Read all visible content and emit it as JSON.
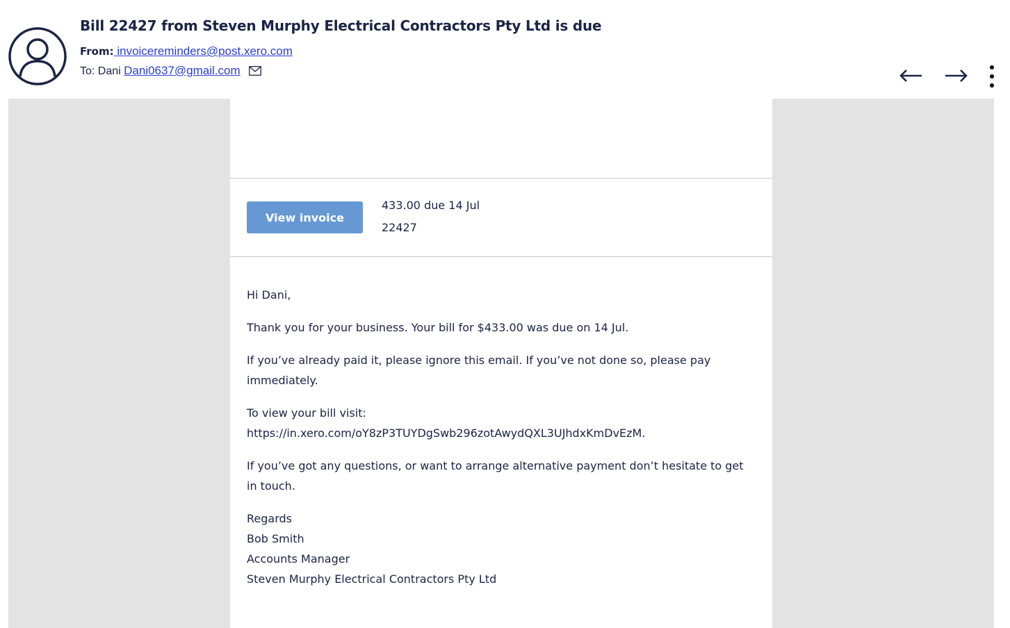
{
  "email": {
    "subject": "Bill 22427 from Steven Murphy Electrical Contractors Pty Ltd is due",
    "from_label": "From:",
    "from_address": " invoicereminders@post.xero.com",
    "to_label": "To: Dani ",
    "to_address": "Dani0637@gmail.com"
  },
  "icons": {
    "avatar": "user-circle-icon",
    "mail": "envelope-icon",
    "prev": "arrow-left-icon",
    "next": "arrow-right-icon",
    "more": "more-vertical-icon"
  },
  "invoice": {
    "button_label": "View invoice",
    "amount_due": "433.00 due 14 Jul",
    "number": "22427"
  },
  "message": {
    "greeting": "Hi Dani,",
    "para1": "Thank you for your business. Your bill for $433.00 was due on 14 Jul.",
    "para2": "If you’ve already paid it, please ignore this email. If you’ve not done so, please pay immediately.",
    "para3_line1": "To view your bill visit:",
    "para3_line2": "https://in.xero.com/oY8zP3TUYDgSwb296zotAwydQXL3UJhdxKmDvEzM.",
    "para4": "If you’ve got any questions, or want to arrange alternative payment don’t hesitate to get in touch.",
    "sign_regards": "Regards",
    "sign_name": "Bob Smith",
    "sign_title": "Accounts Manager",
    "sign_company": "Steven Murphy Electrical Contractors Pty Ltd"
  },
  "colors": {
    "text": "#1b2346",
    "link": "#2b3fd1",
    "button": "#6699d4",
    "page_bg": "#e3e3e3"
  }
}
